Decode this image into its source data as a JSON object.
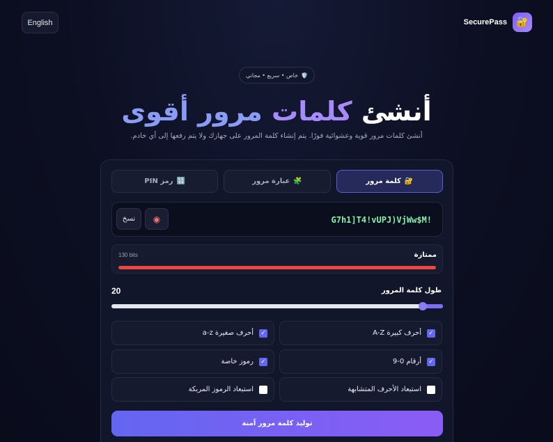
{
  "header": {
    "language_button": "English",
    "brand_name": "SecurePass",
    "brand_icon": "lock-icon"
  },
  "hero": {
    "badge": "خاص • سريع • مجاني",
    "badge_icon": "shield-icon",
    "title_part1": "أنشئ",
    "title_part2": "كلمات",
    "title_part3": "مرور أقوى",
    "subtitle": "أنشئ كلمات مرور قوية وعشوائية فورًا. يتم إنشاء كلمة المرور على جهازك ولا يتم رفعها إلى أي خادم."
  },
  "tabs": [
    {
      "label": "كلمة مرور",
      "icon": "🔐",
      "active": true
    },
    {
      "label": "عبارة مرور",
      "icon": "🧩",
      "active": false
    },
    {
      "label": "رمز PIN",
      "icon": "🔢",
      "active": false
    }
  ],
  "password": {
    "value": "G7h1]T4!vUPJ)VjWw$M!",
    "copy_label": "نسخ",
    "eye_icon": "eye-icon"
  },
  "strength": {
    "label": "ممتازة",
    "bits": "130 bits",
    "fill": 1.0,
    "color": "#ef4444"
  },
  "length": {
    "label": "طول كلمة المرور",
    "value": "20",
    "fraction": 0.06
  },
  "options": [
    {
      "label": "أحرف كبيرة A-Z",
      "checked": true
    },
    {
      "label": "أحرف صغيرة a-z",
      "checked": true
    },
    {
      "label": "أرقام 0-9",
      "checked": true
    },
    {
      "label": "رموز خاصة",
      "checked": true
    },
    {
      "label": "استبعاد الأحرف المتشابهة",
      "checked": false
    },
    {
      "label": "استبعاد الرموز المربكة",
      "checked": false
    }
  ],
  "generate_button": "توليد كلمة مرور آمنة",
  "colors": {
    "accent": "#6366f1",
    "accent2": "#8b5cf6",
    "password_text": "#86efac",
    "strength_bar": "#ef4444"
  }
}
